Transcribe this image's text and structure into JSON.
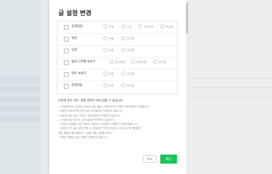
{
  "dialog": {
    "title": "글 설정 변경",
    "settings": [
      {
        "label": "공개설정",
        "options": [
          "전체",
          "이웃",
          "서로이웃",
          "비공개"
        ]
      },
      {
        "label": "댓글",
        "options": [
          "허용",
          "비허용"
        ]
      },
      {
        "label": "공감",
        "options": [
          "허용",
          "비허용"
        ]
      },
      {
        "label": "블로그/카페 보내기",
        "options": [
          "링크허용",
          "본문허용",
          "비허용"
        ]
      },
      {
        "label": "외부 보내기",
        "options": [
          "허용",
          "비허용"
        ]
      },
      {
        "label": "검색허용",
        "options": [
          "허용",
          "비허용"
        ]
      }
    ],
    "notice_title": "다음과 같은 경우, 설정 변경이 되지 않을 수 있습니다.",
    "notices": [
      "- 스마트에디터 2.0에서 작성한 글은 블로그/카페 보내기 허용시 링크허용만 가능합니다.",
      "- 비공개 카테고리에 속한 글은 공개설정이 변경되지 않습니다.",
      "- 비공개 글은 공감, 보내기, 검색 설정이 변경되지 않습니다.",
      "- 스크랩 글은 보내기, 검색 설정이 변경되지 않습니다.",
      "- 구입한 아이템은 다른 브로의 자존먼니 터인해져 선물하기가 불가능합니다.",
      "- 공유되기 전 글은 설정 변경 시, 공유되기 전에 공개 될 수 있어 글 관리를 통한",
      "  설정 변경이 불가능합니다. 글을 직접 수정해주세요.",
      "- 이웃이 제한된 글은 설정이 변경되지 않습니다."
    ],
    "cancel_label": "취소",
    "confirm_label": "확인"
  },
  "colors": {
    "confirm_button": "#17c35a",
    "left_panel": "#e9f0f4"
  }
}
